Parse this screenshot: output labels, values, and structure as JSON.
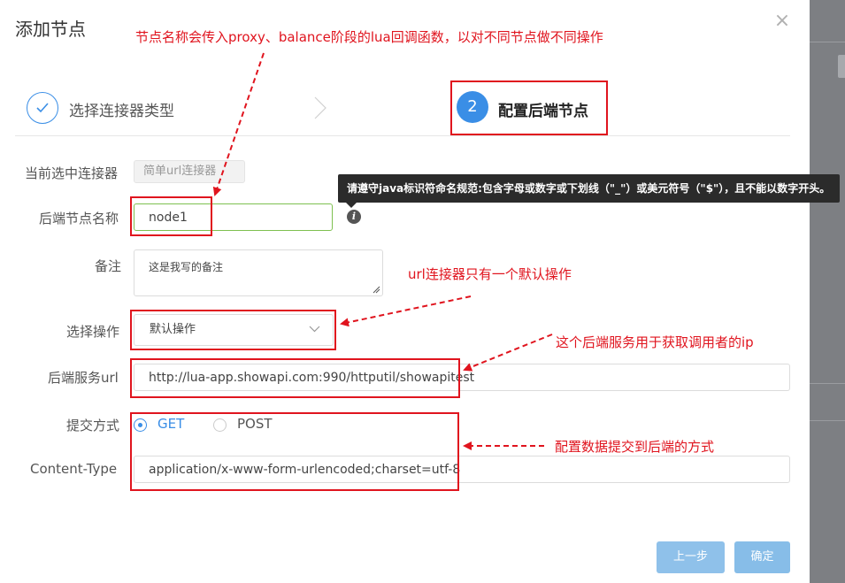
{
  "dialog": {
    "title": "添加节点",
    "close_icon": "close-icon"
  },
  "steps": [
    {
      "number": "",
      "label": "选择连接器类型",
      "status": "done",
      "icon": "check-icon"
    },
    {
      "number": "2",
      "label": "配置后端节点",
      "status": "active"
    }
  ],
  "form": {
    "connector": {
      "label": "当前选中连接器",
      "value": "简单url连接器"
    },
    "node_name": {
      "label": "后端节点名称",
      "value": "node1",
      "info_icon": "info-icon"
    },
    "tooltip": "请遵守java标识符命名规范:包含字母或数字或下划线（\"_\"）或美元符号（\"$\"），且不能以数字开头。",
    "remark": {
      "label": "备注",
      "value": "这是我写的备注"
    },
    "operation": {
      "label": "选择操作",
      "value": "默认操作"
    },
    "service_url": {
      "label": "后端服务url",
      "value": "http://lua-app.showapi.com:990/httputil/showapitest"
    },
    "submit_method": {
      "label": "提交方式",
      "options": [
        "GET",
        "POST"
      ],
      "selected": "GET"
    },
    "content_type": {
      "label": "Content-Type",
      "value": "application/x-www-form-urlencoded;charset=utf-8"
    }
  },
  "footer": {
    "prev_label": "上一步",
    "ok_label": "确定"
  },
  "annotations": {
    "node_name_note": "节点名称会传入proxy、balance阶段的lua回调函数，以对不同节点做不同操作",
    "operation_note": "url连接器只有一个默认操作",
    "url_note": "这个后端服务用于获取调用者的ip",
    "submit_note": "配置数据提交到后端的方式"
  },
  "colors": {
    "accent": "#3a8ee6",
    "annotation_red": "#e0141e",
    "button_blue": "#8fc1ea",
    "focus_green": "#7ec050"
  }
}
